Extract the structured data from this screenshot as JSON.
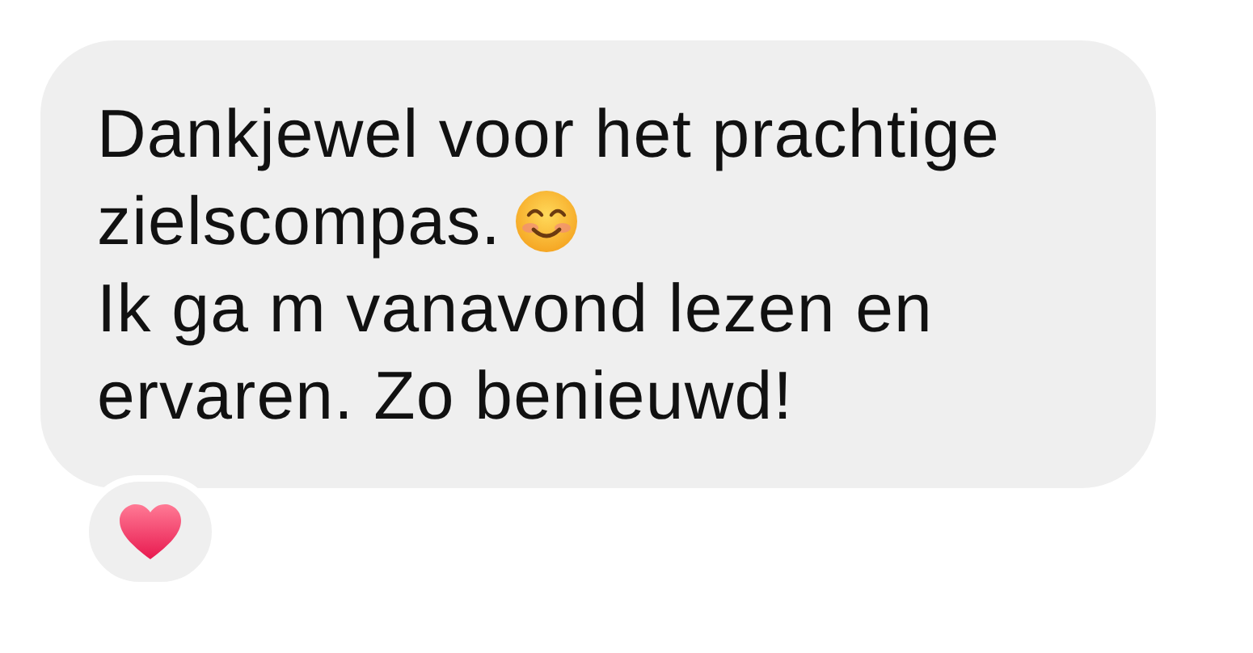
{
  "message": {
    "lines": [
      {
        "kind": "plain",
        "text": "Dankjewel voor het prachtige"
      },
      {
        "kind": "with_smiley",
        "text": "zielscompas."
      },
      {
        "kind": "plain",
        "text": "Ik ga m vanavond lezen en"
      },
      {
        "kind": "plain",
        "text": "ervaren. Zo benieuwd!"
      }
    ]
  },
  "reaction": {
    "kind": "heart"
  }
}
